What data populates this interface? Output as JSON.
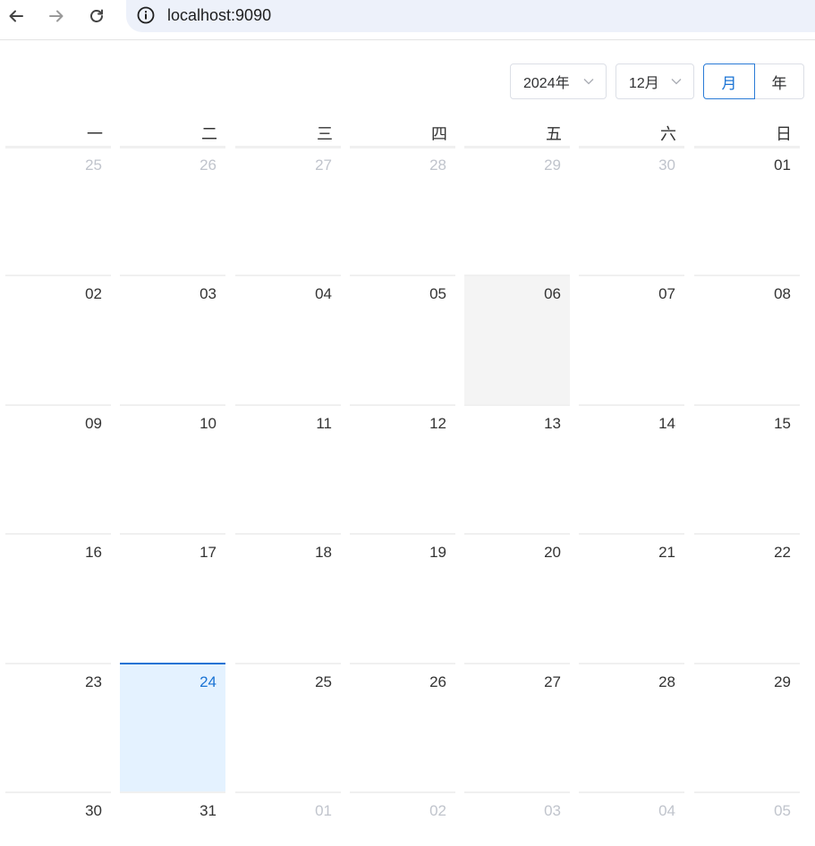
{
  "browser": {
    "url": "localhost:9090"
  },
  "calendar": {
    "year_select": "2024年",
    "month_select": "12月",
    "view_toggle": {
      "month": "月",
      "year": "年",
      "active": "month"
    },
    "weekdays": [
      "一",
      "二",
      "三",
      "四",
      "五",
      "六",
      "日"
    ],
    "weeks": [
      [
        {
          "label": "25",
          "other": true
        },
        {
          "label": "26",
          "other": true
        },
        {
          "label": "27",
          "other": true
        },
        {
          "label": "28",
          "other": true
        },
        {
          "label": "29",
          "other": true
        },
        {
          "label": "30",
          "other": true
        },
        {
          "label": "01",
          "other": false
        }
      ],
      [
        {
          "label": "02",
          "other": false
        },
        {
          "label": "03",
          "other": false
        },
        {
          "label": "04",
          "other": false
        },
        {
          "label": "05",
          "other": false
        },
        {
          "label": "06",
          "other": false,
          "hover": true
        },
        {
          "label": "07",
          "other": false
        },
        {
          "label": "08",
          "other": false
        }
      ],
      [
        {
          "label": "09",
          "other": false
        },
        {
          "label": "10",
          "other": false
        },
        {
          "label": "11",
          "other": false
        },
        {
          "label": "12",
          "other": false
        },
        {
          "label": "13",
          "other": false
        },
        {
          "label": "14",
          "other": false
        },
        {
          "label": "15",
          "other": false
        }
      ],
      [
        {
          "label": "16",
          "other": false
        },
        {
          "label": "17",
          "other": false
        },
        {
          "label": "18",
          "other": false
        },
        {
          "label": "19",
          "other": false
        },
        {
          "label": "20",
          "other": false
        },
        {
          "label": "21",
          "other": false
        },
        {
          "label": "22",
          "other": false
        }
      ],
      [
        {
          "label": "23",
          "other": false
        },
        {
          "label": "24",
          "other": false,
          "selected": true
        },
        {
          "label": "25",
          "other": false
        },
        {
          "label": "26",
          "other": false
        },
        {
          "label": "27",
          "other": false
        },
        {
          "label": "28",
          "other": false
        },
        {
          "label": "29",
          "other": false
        }
      ],
      [
        {
          "label": "30",
          "other": false
        },
        {
          "label": "31",
          "other": false
        },
        {
          "label": "01",
          "other": true
        },
        {
          "label": "02",
          "other": true
        },
        {
          "label": "03",
          "other": true
        },
        {
          "label": "04",
          "other": true
        },
        {
          "label": "05",
          "other": true
        }
      ]
    ]
  },
  "colors": {
    "accent": "#1a73d4",
    "selected_bg": "#e4f2ff",
    "hover_bg": "#f4f4f4",
    "muted_text": "#c0c4cc"
  }
}
